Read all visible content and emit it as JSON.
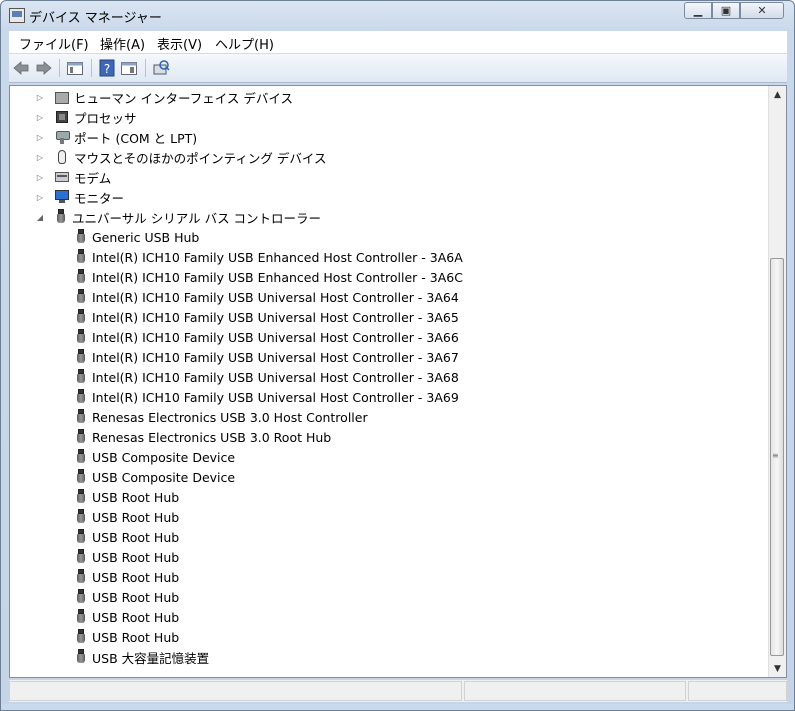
{
  "window": {
    "title": "デバイス マネージャー"
  },
  "menubar": {
    "items": [
      "ファイル(F)",
      "操作(A)",
      "表示(V)",
      "ヘルプ(H)"
    ]
  },
  "toolbar": {
    "buttons": [
      "back-icon",
      "forward-icon",
      "properties-view-icon",
      "help-icon",
      "view-icon",
      "scan-hardware-icon"
    ]
  },
  "tree": {
    "categories": [
      {
        "label": "ヒューマン インターフェイス デバイス",
        "icon": "hid-icon",
        "expanded": false
      },
      {
        "label": "プロセッサ",
        "icon": "processor-icon",
        "expanded": false
      },
      {
        "label": "ポート (COM と LPT)",
        "icon": "port-icon",
        "expanded": false
      },
      {
        "label": "マウスとそのほかのポインティング デバイス",
        "icon": "mouse-icon",
        "expanded": false
      },
      {
        "label": "モデム",
        "icon": "modem-icon",
        "expanded": false
      },
      {
        "label": "モニター",
        "icon": "monitor-icon",
        "expanded": false
      },
      {
        "label": "ユニバーサル シリアル バス コントローラー",
        "icon": "usb-icon",
        "expanded": true
      }
    ],
    "usb_children": [
      "Generic USB Hub",
      "Intel(R) ICH10 Family USB Enhanced Host Controller - 3A6A",
      "Intel(R) ICH10 Family USB Enhanced Host Controller - 3A6C",
      "Intel(R) ICH10 Family USB Universal Host Controller - 3A64",
      "Intel(R) ICH10 Family USB Universal Host Controller - 3A65",
      "Intel(R) ICH10 Family USB Universal Host Controller - 3A66",
      "Intel(R) ICH10 Family USB Universal Host Controller - 3A67",
      "Intel(R) ICH10 Family USB Universal Host Controller - 3A68",
      "Intel(R) ICH10 Family USB Universal Host Controller - 3A69",
      "Renesas Electronics USB 3.0 Host Controller",
      "Renesas Electronics USB 3.0 Root Hub",
      "USB Composite Device",
      "USB Composite Device",
      "USB Root Hub",
      "USB Root Hub",
      "USB Root Hub",
      "USB Root Hub",
      "USB Root Hub",
      "USB Root Hub",
      "USB Root Hub",
      "USB Root Hub",
      "USB 大容量記憶装置"
    ]
  },
  "scrollbar": {
    "position": "bottom"
  }
}
